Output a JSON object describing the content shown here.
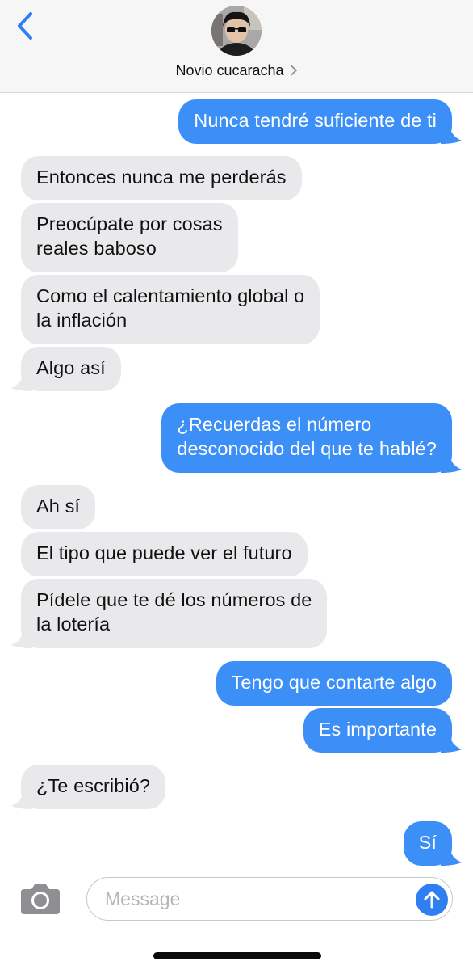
{
  "header": {
    "contact_name": "Novio cucaracha",
    "back_icon": "chevron-left-icon",
    "accent": "#3b8ff6"
  },
  "messages": [
    {
      "direction": "sent",
      "text": "Nunca tendré suficiente de ti"
    },
    {
      "direction": "received",
      "text": "Entonces nunca me perderás"
    },
    {
      "direction": "received",
      "text": "Preocúpate por cosas\nreales baboso"
    },
    {
      "direction": "received",
      "text": "Como el calentamiento global o\nla inflación"
    },
    {
      "direction": "received",
      "text": "Algo así"
    },
    {
      "direction": "sent",
      "text": "¿Recuerdas el número\ndesconocido del que te hablé?"
    },
    {
      "direction": "received",
      "text": "Ah sí"
    },
    {
      "direction": "received",
      "text": "El tipo que puede ver el futuro"
    },
    {
      "direction": "received",
      "text": "Pídele que te dé los números de\nla lotería"
    },
    {
      "direction": "sent",
      "text": "Tengo que contarte algo"
    },
    {
      "direction": "sent",
      "text": "Es importante"
    },
    {
      "direction": "received",
      "text": "¿Te escribió?"
    },
    {
      "direction": "sent",
      "text": "Sí"
    }
  ],
  "composer": {
    "placeholder": "Message",
    "camera_icon": "camera-icon",
    "send_icon": "arrow-up-icon"
  },
  "colors": {
    "sent_bubble": "#3b8ff6",
    "received_bubble": "#e9e9eb"
  }
}
